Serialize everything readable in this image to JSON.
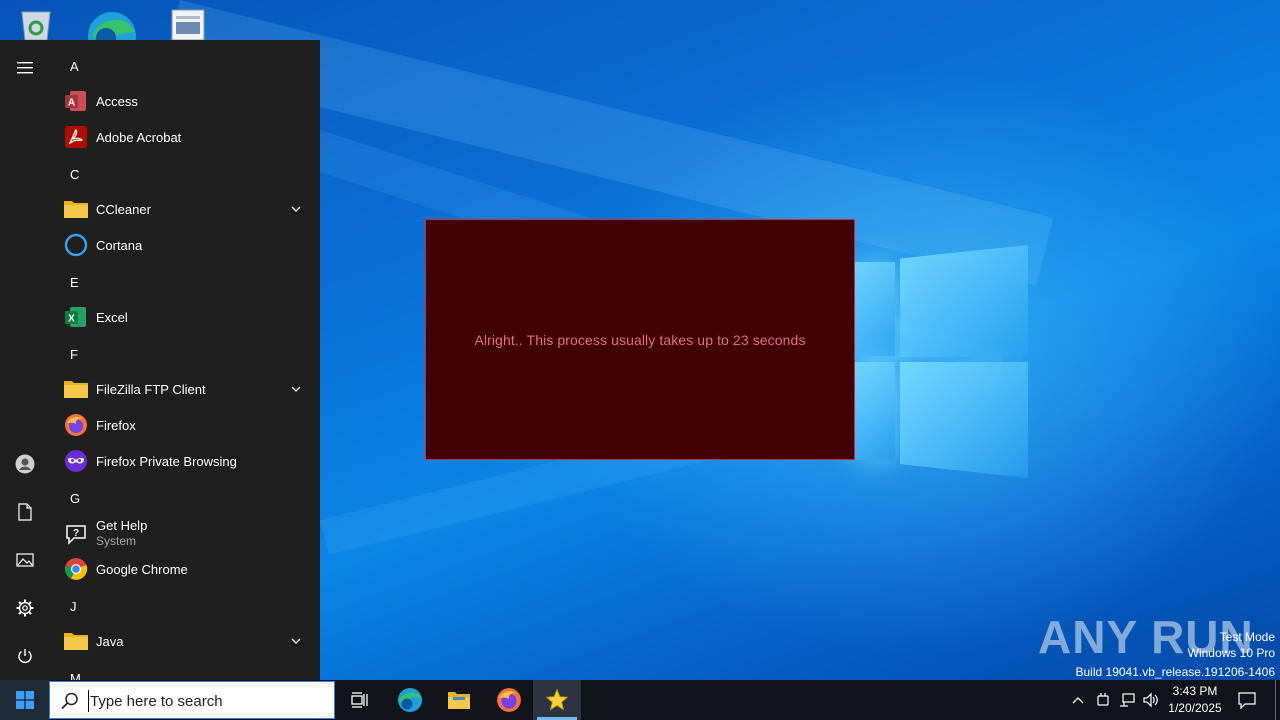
{
  "desktop": {
    "icons": [
      "recycle-bin",
      "microsoft-edge",
      "document"
    ]
  },
  "start_menu": {
    "rail": [
      "hamburger-menu",
      "user-account",
      "documents",
      "pictures",
      "settings",
      "power"
    ],
    "groups": [
      {
        "letter": "A",
        "apps": [
          {
            "name": "Access",
            "icon": "access-icon"
          },
          {
            "name": "Adobe Acrobat",
            "icon": "acrobat-icon"
          }
        ]
      },
      {
        "letter": "C",
        "apps": [
          {
            "name": "CCleaner",
            "icon": "folder-icon",
            "expandable": true
          },
          {
            "name": "Cortana",
            "icon": "cortana-icon"
          }
        ]
      },
      {
        "letter": "E",
        "apps": [
          {
            "name": "Excel",
            "icon": "excel-icon"
          }
        ]
      },
      {
        "letter": "F",
        "apps": [
          {
            "name": "FileZilla FTP Client",
            "icon": "folder-icon",
            "expandable": true
          },
          {
            "name": "Firefox",
            "icon": "firefox-icon"
          },
          {
            "name": "Firefox Private Browsing",
            "icon": "firefox-private-icon"
          }
        ]
      },
      {
        "letter": "G",
        "apps": [
          {
            "name": "Get Help",
            "sub": "System",
            "icon": "get-help-icon"
          },
          {
            "name": "Google Chrome",
            "icon": "chrome-icon"
          }
        ]
      },
      {
        "letter": "J",
        "apps": [
          {
            "name": "Java",
            "icon": "folder-icon",
            "expandable": true
          }
        ]
      },
      {
        "letter": "M",
        "apps": []
      }
    ]
  },
  "dialog": {
    "message": "Alright.. This process usually takes up to 23 seconds",
    "background": "#400000",
    "text_color": "#e0708a"
  },
  "watermark": {
    "brand": "ANY RUN",
    "mode": "Test Mode",
    "edition": "Windows 10 Pro",
    "build": "Build 19041.vb_release.191206-1406"
  },
  "taskbar": {
    "search_placeholder": "Type here to search",
    "pinned": [
      "task-view",
      "microsoft-edge",
      "file-explorer",
      "firefox",
      "star-app"
    ],
    "active": "star-app",
    "clock": {
      "time": "3:43 PM",
      "date": "1/20/2025"
    }
  },
  "colors": {
    "accent": "#0078d7",
    "taskbar": "#101419",
    "start_menu": "#1f1f1f"
  }
}
